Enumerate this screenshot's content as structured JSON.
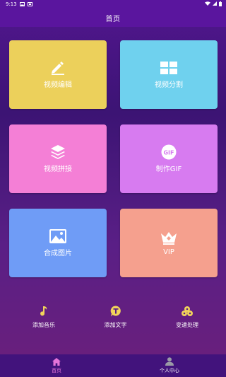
{
  "status_bar": {
    "time": "9:13",
    "icons": [
      "image-icon",
      "gallery-icon",
      "wifi-icon",
      "signal-icon",
      "battery-icon"
    ]
  },
  "header": {
    "title": "首页"
  },
  "tiles": [
    {
      "label": "视频编辑",
      "icon": "pencil-icon",
      "color": "#ecd05b"
    },
    {
      "label": "视频分割",
      "icon": "grid-split-icon",
      "color": "#6fd1ee"
    },
    {
      "label": "视频拼接",
      "icon": "layers-icon",
      "color": "#f47fd6"
    },
    {
      "label": "制作GIF",
      "icon": "gif-icon",
      "icon_text": "GIF",
      "color": "#d77bf0"
    },
    {
      "label": "合成图片",
      "icon": "image-icon",
      "color": "#6f9cf6"
    },
    {
      "label": "VIP",
      "icon": "crown-icon",
      "color": "#f5a08e"
    }
  ],
  "tools": [
    {
      "label": "添加音乐",
      "icon": "music-note-icon"
    },
    {
      "label": "添加文字",
      "icon": "text-icon"
    },
    {
      "label": "变速处理",
      "icon": "speed-icon"
    }
  ],
  "bottom_nav": [
    {
      "label": "首页",
      "icon": "home-icon",
      "active": true,
      "color": "#e574d8"
    },
    {
      "label": "个人中心",
      "icon": "person-icon",
      "active": false,
      "color": "#ffffff"
    }
  ]
}
